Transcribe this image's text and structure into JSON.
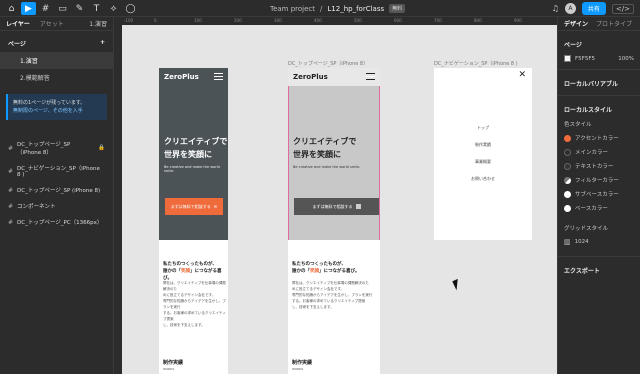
{
  "toolbar": {
    "tools": [
      "⌂",
      "▶",
      "#",
      "▭",
      "✎",
      "T",
      "⟡",
      "◯"
    ],
    "project": "Team project",
    "separator": "/",
    "file": "L12_hp_forClass",
    "badge": "無料",
    "avatar": "A",
    "share": "共有",
    "code": "</>"
  },
  "left_panel": {
    "tab_layers": "レイヤー",
    "tab_assets": "アセット",
    "current_page": "1.演習",
    "pages_heading": "ページ",
    "add": "+",
    "pages": [
      "1.演習",
      "2.模範解答"
    ],
    "notice_line1": "無料の1ページが残っています。",
    "notice_line2": "無制限のページ、その他を入手",
    "layers": [
      "DC_トップページ_SP（iPhone 8）",
      "DC_ナビゲーション_SP（iPhone 8 )",
      "DC_トップページ_SP (iPhone 8)",
      "コンポーネント",
      "DC_トップページ_PC（1366px）"
    ]
  },
  "right_panel": {
    "tab_design": "デザイン",
    "tab_prototype": "プロトタイプ",
    "page_heading": "ページ",
    "page_color": "F5F5F5",
    "page_opacity": "100%",
    "local_variables": "ローカルバリアブル",
    "local_styles": "ローカルスタイル",
    "color_styles": "色スタイル",
    "colors": [
      {
        "name": "アクセントカラー",
        "color": "#f06b3b"
      },
      {
        "name": "メインカラー",
        "color": "#2d2d2d"
      },
      {
        "name": "テキストカラー",
        "color": "#333333"
      },
      {
        "name": "フィルターカラー",
        "color": "#666666"
      },
      {
        "name": "サブベースカラー",
        "color": "#ffffff"
      },
      {
        "name": "ベースカラー",
        "color": "#ffffff"
      }
    ],
    "grid_styles": "グリッドスタイル",
    "grid_value": "1024",
    "export": "エクスポート"
  },
  "canvas": {
    "ruler_marks": [
      "-100",
      "0",
      "100",
      "200",
      "300",
      "400",
      "500",
      "600",
      "700",
      "800",
      "900"
    ],
    "frame1_label": "",
    "frame2_label": "DC_トップページ_SP（iPhone 8）",
    "frame3_label": "DC_ナビゲーション_SP（iPhone 8 )",
    "logo": "ZeroPlus",
    "headline1": "クリエイティブで",
    "headline2": "世界を笑顔に",
    "subline": "Be creative and make the world smile.",
    "cta": "まずは無料で相談する",
    "about1": "私たちのつくったものが、",
    "about2a": "誰かの「",
    "about2b": "笑顔",
    "about2c": "」につながる喜び。",
    "about_sm1": "弊社は、クリエイティブを仕事場の課題解決のた",
    "about_sm2": "めに役立てるデザイン会社です。",
    "about_sm3": "専門的な知識からアイデアを生かし、プランを実行",
    "about_sm4": "する。お客様の求めているクリエイティブ提案",
    "about_sm5": "し、技術を下支えします。",
    "works": "制作実績",
    "works_en": "WORKS",
    "nav": [
      "トップ",
      "制作実績",
      "事業概要",
      "お問い合わせ"
    ],
    "close": "✕"
  }
}
